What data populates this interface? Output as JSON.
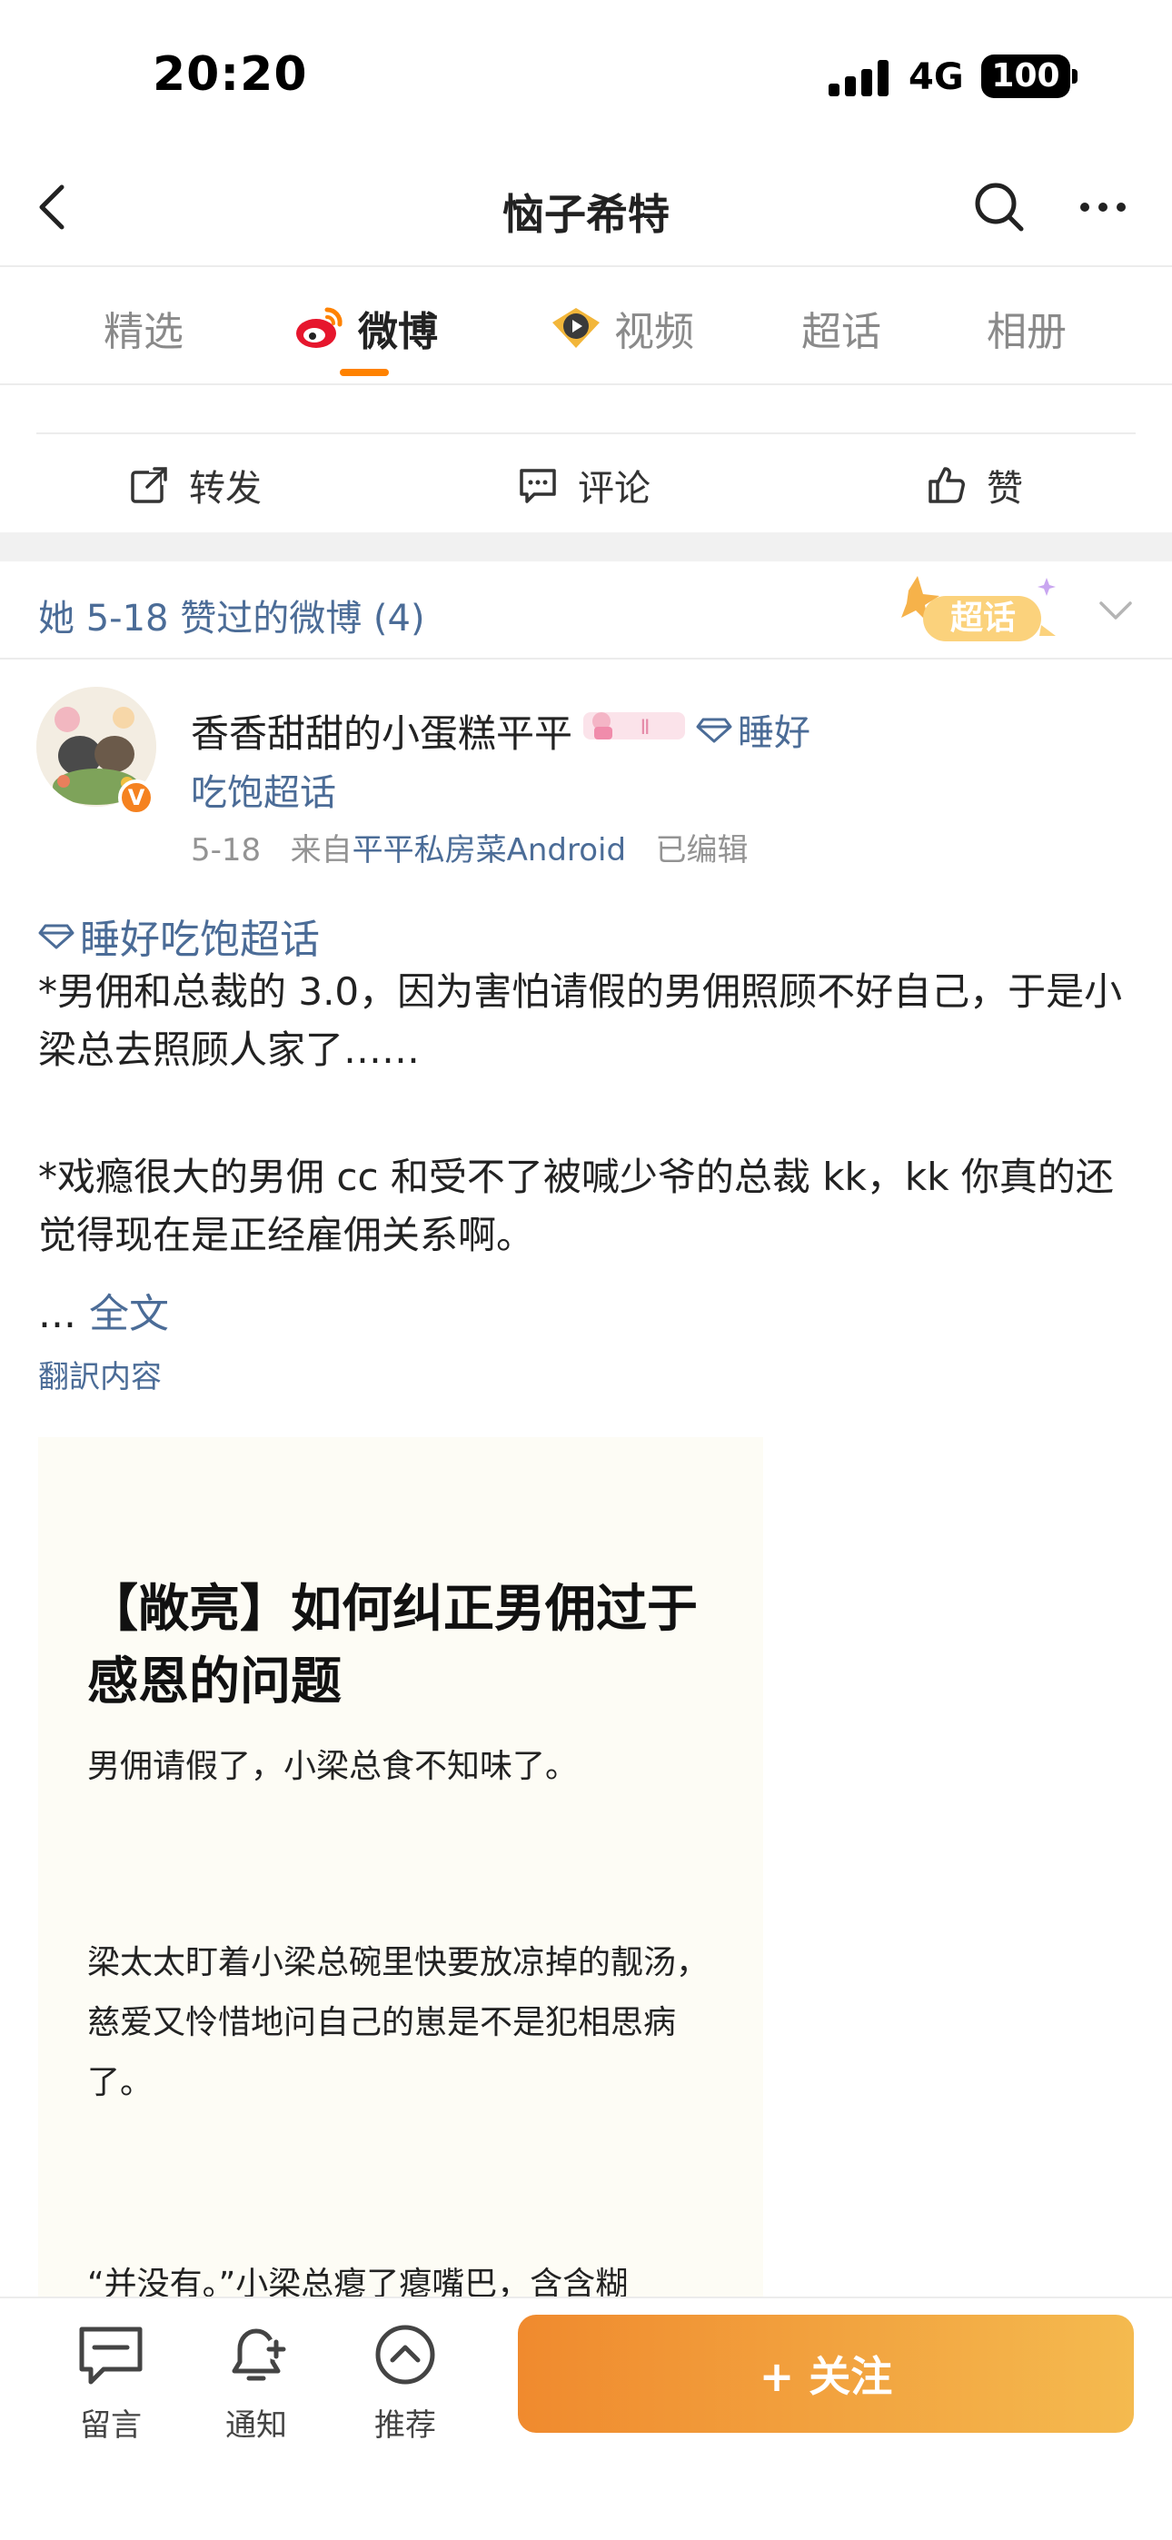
{
  "status_bar": {
    "time": "20:20",
    "network": "4G",
    "battery": "100"
  },
  "nav": {
    "title": "恼子希特"
  },
  "tabs": [
    {
      "label": "精选"
    },
    {
      "label": "微博"
    },
    {
      "label": "视频"
    },
    {
      "label": "超话"
    },
    {
      "label": "相册"
    }
  ],
  "actions": {
    "repost": "转发",
    "comment": "评论",
    "like": "赞"
  },
  "liked_header": {
    "text": "她 5-18 赞过的微博 (4)",
    "badge": "超话"
  },
  "post": {
    "author": "香香甜甜的小蛋糕平平",
    "topic_inline": "睡好",
    "topic_line2": "吃饱超话",
    "date": "5-18",
    "from_prefix": "来自",
    "source": "平平私房菜Android",
    "edited": "已编辑",
    "topic": "睡好吃饱超话",
    "para1": "*男佣和总裁的 3.0，因为害怕请假的男佣照顾不好自己，于是小梁总去照顾人家了……",
    "para2": "*戏瘾很大的男佣 cc 和受不了被喊少爷的总裁 kk，kk 你真的还觉得现在是正经雇佣关系啊。",
    "ellipsis": "...",
    "full_text": "全文",
    "translate": "翻訳内容",
    "image": {
      "title": "【敞亮】如何纠正男佣过于感恩的问题",
      "p1": "男佣请假了，小梁总食不知味了。",
      "p2": "梁太太盯着小梁总碗里快要放凉掉的靓汤，慈爱又怜惜地问自己的崽是不是犯相思病了。",
      "p3": "“并没有。”小梁总瘪了瘪嘴巴，含含糊"
    }
  },
  "bottom_bar": {
    "message": "留言",
    "notify": "通知",
    "recommend": "推荐",
    "follow": "+ 关注"
  },
  "colors": {
    "accent": "#ff8200",
    "link": "#4b6c97",
    "follow_gradient_start": "#f08a2e",
    "follow_gradient_end": "#f4ba4f"
  }
}
